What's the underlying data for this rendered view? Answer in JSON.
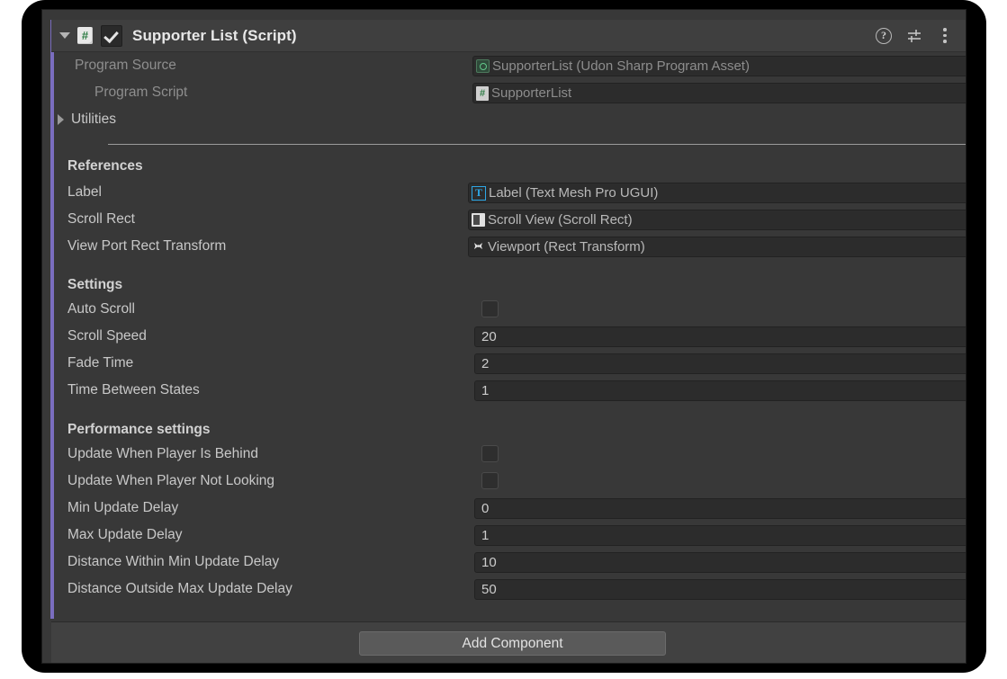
{
  "component": {
    "title": "Supporter List (Script)",
    "enabled": true,
    "expanded": true,
    "script_icon": "#",
    "header_icons": [
      {
        "name": "help-icon",
        "glyph": "?"
      },
      {
        "name": "preset-icon",
        "glyph": "preset-sliders"
      },
      {
        "name": "kebab-menu-icon",
        "glyph": "⋮"
      }
    ]
  },
  "udon": {
    "program_source_label": "Program Source",
    "program_source_value": "SupporterList (Udon Sharp Program Asset)",
    "program_script_label": "Program Script",
    "program_script_value": "SupporterList",
    "utilities_label": "Utilities",
    "utilities_expanded": false
  },
  "references": {
    "heading": "References",
    "rows": [
      {
        "label": "Label",
        "value": "Label (Text Mesh Pro UGUI)",
        "icon": "tmp-text-icon"
      },
      {
        "label": "Scroll Rect",
        "value": "Scroll View (Scroll Rect)",
        "icon": "scroll-rect-icon"
      },
      {
        "label": "View Port Rect Transform",
        "value": "Viewport (Rect Transform)",
        "icon": "rect-transform-icon"
      }
    ]
  },
  "settings": {
    "heading": "Settings",
    "rows": [
      {
        "label": "Auto Scroll",
        "type": "checkbox",
        "value": false
      },
      {
        "label": "Scroll Speed",
        "type": "number",
        "value": "20"
      },
      {
        "label": "Fade Time",
        "type": "number",
        "value": "2"
      },
      {
        "label": "Time Between States",
        "type": "number",
        "value": "1"
      }
    ]
  },
  "performance": {
    "heading": "Performance settings",
    "rows": [
      {
        "label": "Update When Player Is Behind",
        "type": "checkbox",
        "value": false
      },
      {
        "label": "Update When Player Not Looking",
        "type": "checkbox",
        "value": false
      },
      {
        "label": "Min Update Delay",
        "type": "number",
        "value": "0"
      },
      {
        "label": "Max Update Delay",
        "type": "number",
        "value": "1"
      },
      {
        "label": "Distance Within Min Update Delay",
        "type": "number",
        "value": "10"
      },
      {
        "label": "Distance Outside Max Update Delay",
        "type": "number",
        "value": "50"
      }
    ]
  },
  "footer": {
    "add_component_label": "Add Component"
  },
  "colors": {
    "accent_strip": "#7a6dbf",
    "panel_bg": "#383838",
    "header_bg": "#3f3f3f",
    "field_bg": "#2c2c2c",
    "tmp_icon": "#2ea8e6",
    "script_green": "#2f7d46"
  }
}
